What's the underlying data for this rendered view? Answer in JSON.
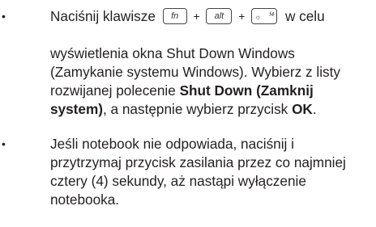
{
  "item1": {
    "prefix": "Naciśnij klawisze",
    "key_fn": "fn",
    "key_alt": "alt",
    "key_f4": "f4",
    "plus": "+",
    "suffix": "w celu",
    "line2": "wyświetlenia okna Shut Down Windows",
    "line3": "(Zamykanie systemu Windows). Wybierz z listy",
    "line4_pre": "rozwijanej polecenie ",
    "line4_bold": "Shut Down (Zamknij",
    "line5_bold": "system)",
    "line5_mid": ", a następnie wybierz przycisk ",
    "line5_ok": "OK",
    "line5_end": "."
  },
  "item2": {
    "line1": "Jeśli notebook nie odpowiada, naciśnij i",
    "line2": "przytrzymaj przycisk zasilania przez co najmniej",
    "line3": "cztery (4) sekundy, aż nastąpi wyłączenie",
    "line4": "notebooka."
  },
  "bullet_char": "•"
}
